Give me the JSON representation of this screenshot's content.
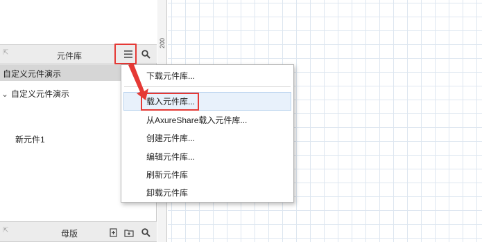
{
  "library_panel": {
    "title": "元件库",
    "selected_library": "自定义元件演示",
    "tree_root": "自定义元件演示",
    "widget": "新元件1"
  },
  "master_panel": {
    "title": "母版"
  },
  "ruler": {
    "label": "200"
  },
  "library_menu": {
    "items": [
      "下载元件库...",
      "载入元件库...",
      "从AxureShare载入元件库...",
      "创建元件库...",
      "编辑元件库...",
      "刷新元件库",
      "卸载元件库"
    ]
  },
  "colors": {
    "highlight_red": "#e53935",
    "menu_hover": "#e8f1fb",
    "header_bg": "#ececec",
    "selector_bg": "#d6d6d6"
  },
  "icons": {
    "menu": "hamburger-menu-icon",
    "search": "search-icon",
    "collapse": "collapse-arrow-icon",
    "add_master": "add-page-icon",
    "add_folder": "add-folder-icon"
  }
}
